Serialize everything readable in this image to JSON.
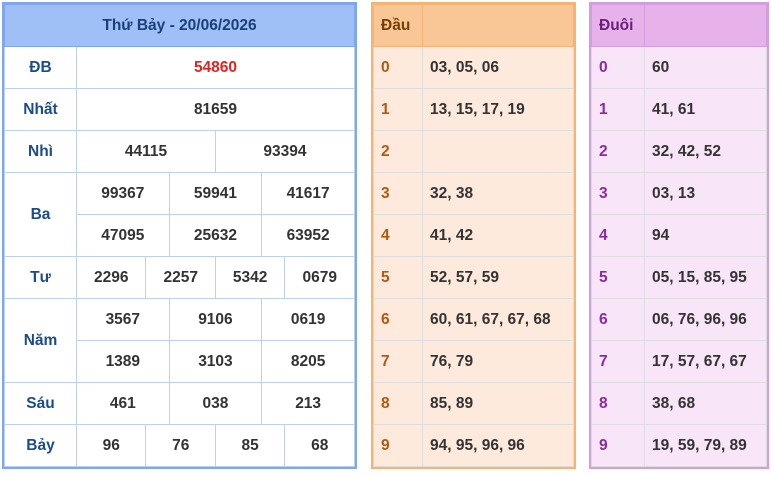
{
  "results": {
    "title": "Thứ Bảy - 20/06/2026",
    "db": {
      "label": "ĐB",
      "value": "54860"
    },
    "nhat": {
      "label": "Nhất",
      "value": "81659"
    },
    "nhi": {
      "label": "Nhì",
      "values": [
        "44115",
        "93394"
      ]
    },
    "ba": {
      "label": "Ba",
      "values": [
        "99367",
        "59941",
        "41617",
        "47095",
        "25632",
        "63952"
      ]
    },
    "tu": {
      "label": "Tư",
      "values": [
        "2296",
        "2257",
        "5342",
        "0679"
      ]
    },
    "nam": {
      "label": "Năm",
      "values": [
        "3567",
        "9106",
        "0619",
        "1389",
        "3103",
        "8205"
      ]
    },
    "sau": {
      "label": "Sáu",
      "values": [
        "461",
        "038",
        "213"
      ]
    },
    "bay": {
      "label": "Bảy",
      "values": [
        "96",
        "76",
        "85",
        "68"
      ]
    }
  },
  "dau": {
    "header": "Đầu",
    "rows": [
      {
        "digit": "0",
        "values": "03, 05, 06"
      },
      {
        "digit": "1",
        "values": "13, 15, 17, 19"
      },
      {
        "digit": "2",
        "values": ""
      },
      {
        "digit": "3",
        "values": "32, 38"
      },
      {
        "digit": "4",
        "values": "41, 42"
      },
      {
        "digit": "5",
        "values": "52, 57, 59"
      },
      {
        "digit": "6",
        "values": "60, 61, 67, 67, 68"
      },
      {
        "digit": "7",
        "values": "76, 79"
      },
      {
        "digit": "8",
        "values": "85, 89"
      },
      {
        "digit": "9",
        "values": "94, 95, 96, 96"
      }
    ]
  },
  "duoi": {
    "header": "Đuôi",
    "rows": [
      {
        "digit": "0",
        "values": "60"
      },
      {
        "digit": "1",
        "values": "41, 61"
      },
      {
        "digit": "2",
        "values": "32, 42, 52"
      },
      {
        "digit": "3",
        "values": "03, 13"
      },
      {
        "digit": "4",
        "values": "94"
      },
      {
        "digit": "5",
        "values": "05, 15, 85, 95"
      },
      {
        "digit": "6",
        "values": "06, 76, 96, 96"
      },
      {
        "digit": "7",
        "values": "17, 57, 67, 67"
      },
      {
        "digit": "8",
        "values": "38, 68"
      },
      {
        "digit": "9",
        "values": "19, 59, 79, 89"
      }
    ]
  }
}
